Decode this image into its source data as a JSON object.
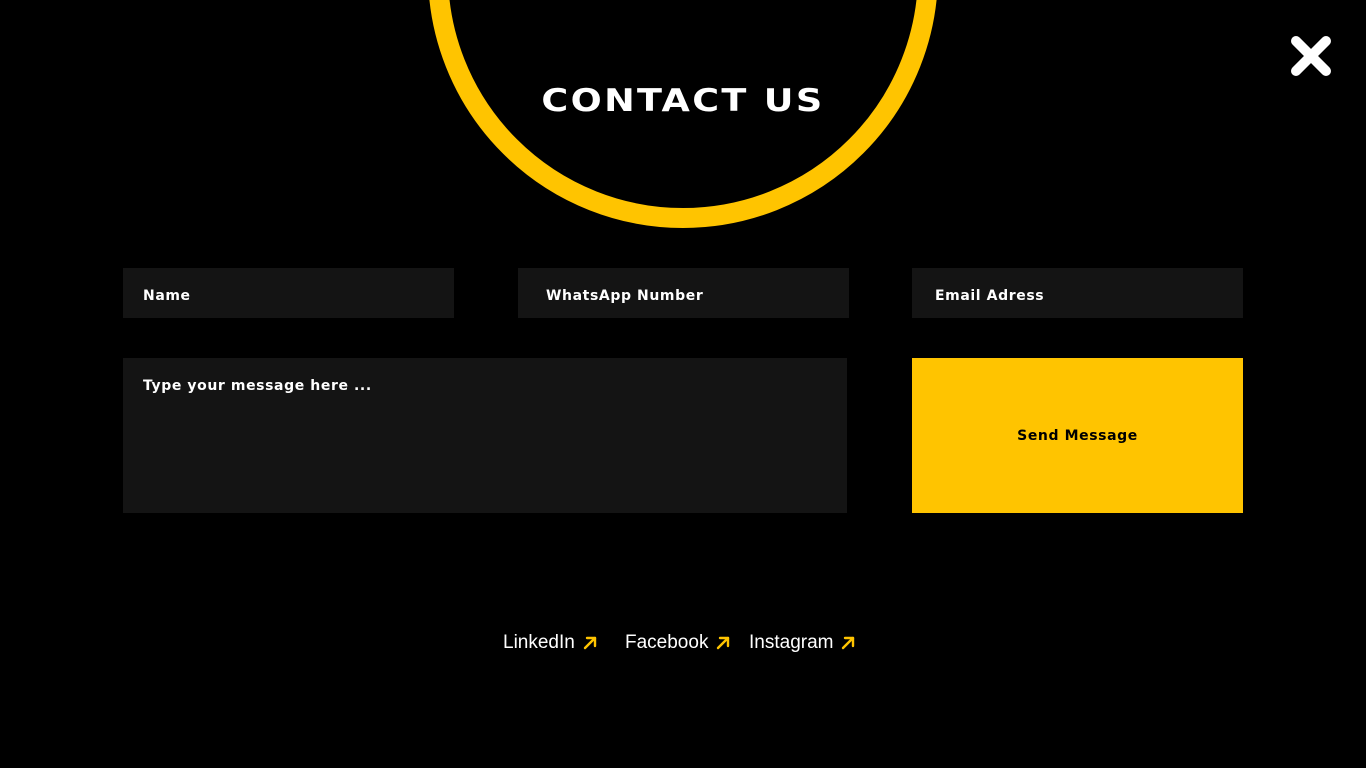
{
  "header": {
    "title": "CONTACT US",
    "close_icon": "close-icon"
  },
  "form": {
    "name_placeholder": "Name",
    "whatsapp_placeholder": "WhatsApp Number",
    "email_placeholder": "Email Adress",
    "message_placeholder": "Type your message here ...",
    "send_label": "Send Message"
  },
  "social": {
    "links": [
      {
        "label": "LinkedIn",
        "icon": "arrow-up-right-icon"
      },
      {
        "label": "Facebook",
        "icon": "arrow-up-right-icon"
      },
      {
        "label": "Instagram",
        "icon": "arrow-up-right-icon"
      }
    ]
  },
  "colors": {
    "background": "#000000",
    "accent": "#FFC400",
    "field_background": "#141414",
    "text": "#FFFFFF"
  }
}
